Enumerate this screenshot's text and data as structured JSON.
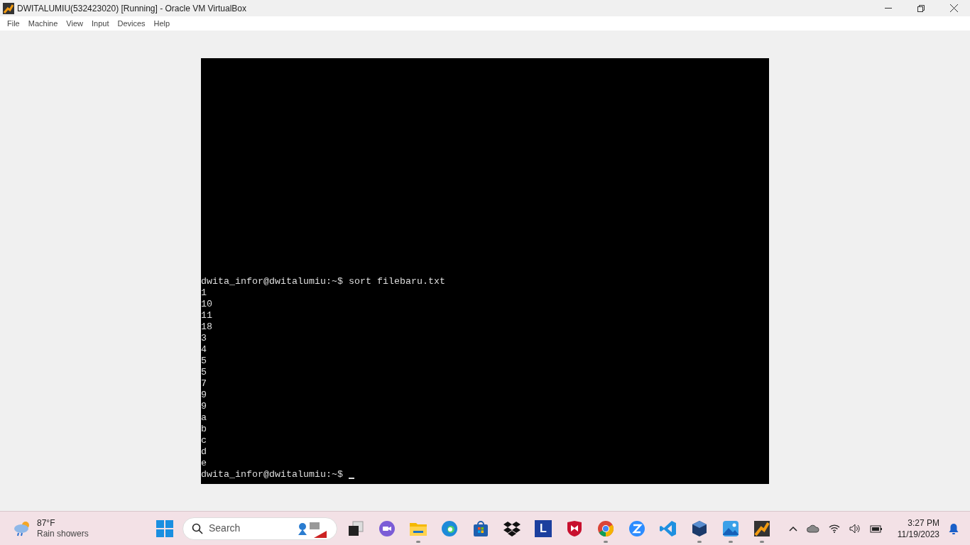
{
  "window": {
    "title": "DWITALUMIU(532423020) [Running] - Oracle VM VirtualBox"
  },
  "menu": [
    "File",
    "Machine",
    "View",
    "Input",
    "Devices",
    "Help"
  ],
  "terminal": {
    "lines": [
      "dwita_infor@dwitalumiu:~$ sort filebaru.txt",
      "1",
      "10",
      "11",
      "18",
      "3",
      "4",
      "5",
      "5",
      "7",
      "9",
      "9",
      "a",
      "b",
      "c",
      "d",
      "e"
    ],
    "prompt": "dwita_infor@dwitalumiu:~$ "
  },
  "taskbar": {
    "weather": {
      "temperature": "87°F",
      "condition": "Rain showers"
    },
    "search": {
      "placeholder": "Search"
    },
    "apps": [
      {
        "kind": "taskview",
        "running": false
      },
      {
        "kind": "chat",
        "running": false
      },
      {
        "kind": "folder",
        "running": true
      },
      {
        "kind": "edge",
        "running": false
      },
      {
        "kind": "store",
        "running": false
      },
      {
        "kind": "dropbox",
        "running": false
      },
      {
        "kind": "letter",
        "label": "L",
        "running": false
      },
      {
        "kind": "shield",
        "running": false
      },
      {
        "kind": "chrome",
        "running": true
      },
      {
        "kind": "zoom",
        "running": false
      },
      {
        "kind": "vscode",
        "running": false
      },
      {
        "kind": "cube",
        "running": true
      },
      {
        "kind": "photos",
        "running": true
      },
      {
        "kind": "vbox",
        "running": true
      }
    ],
    "clock": {
      "time": "3:27 PM",
      "date": "11/19/2023"
    }
  }
}
